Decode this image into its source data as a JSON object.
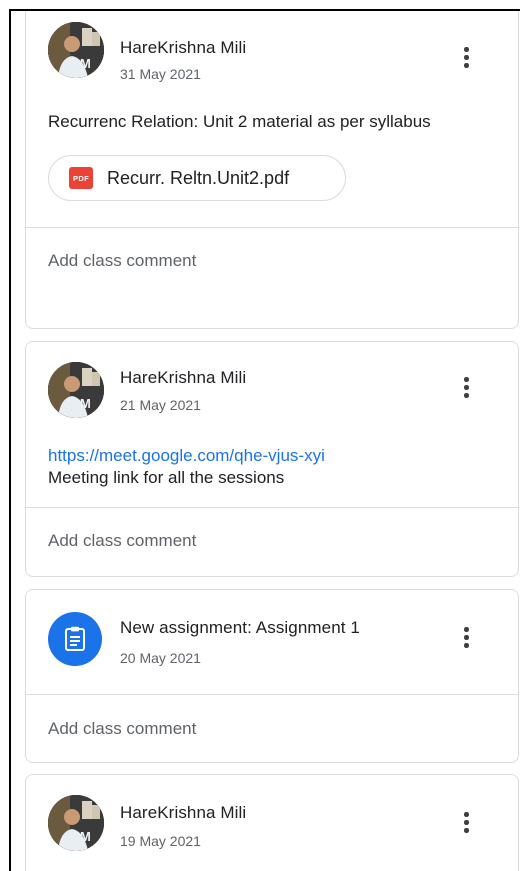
{
  "posts": [
    {
      "author": "HareKrishna Mili",
      "date": "31 May 2021",
      "text": "Recurrenc Relation: Unit 2 material as per syllabus",
      "attachment": {
        "type_badge": "PDF",
        "name": "Recurr. Reltn.Unit2.pdf"
      },
      "comment_placeholder": "Add class comment"
    },
    {
      "author": "HareKrishna Mili",
      "date": "21 May 2021",
      "link": "https://meet.google.com/qhe-vjus-xyi",
      "text": "Meeting link for all the sessions",
      "comment_placeholder": "Add class comment"
    },
    {
      "title": "New assignment: Assignment 1",
      "date": "20 May 2021",
      "icon": "assignment-icon",
      "comment_placeholder": "Add class comment"
    },
    {
      "author": "HareKrishna Mili",
      "date": "19 May 2021"
    }
  ],
  "colors": {
    "accent": "#1a73e8",
    "pdf": "#ea4335",
    "border": "#dadce0",
    "secondary_text": "#5f6368"
  }
}
